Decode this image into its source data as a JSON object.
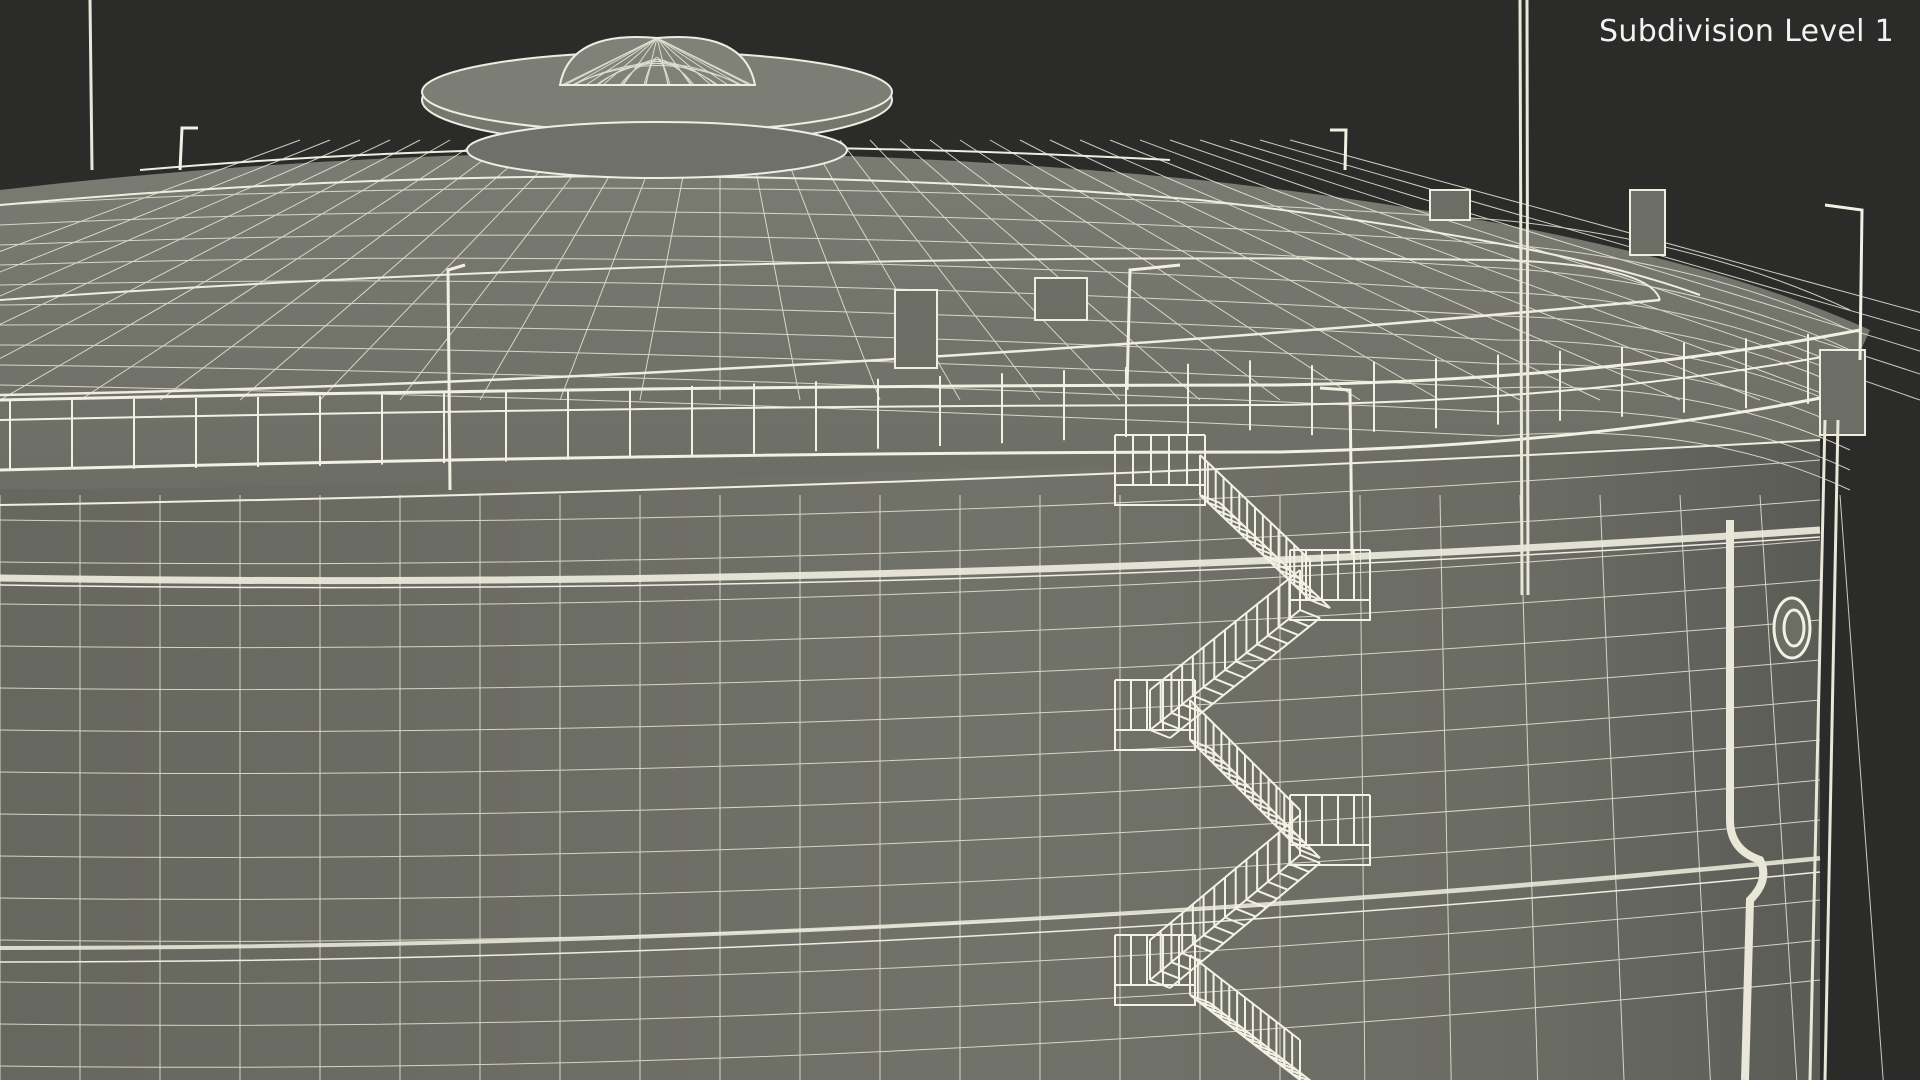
{
  "overlay": {
    "subdivision_label": "Subdivision Level 1"
  },
  "scene": {
    "subject": "storage-tank-wireframe",
    "colors": {
      "background": "#2b2c2a",
      "surface": "#6e6f67",
      "surface_dark": "#5f605a",
      "wire": "#e9e7d8",
      "label": "#f2f2f2"
    }
  }
}
